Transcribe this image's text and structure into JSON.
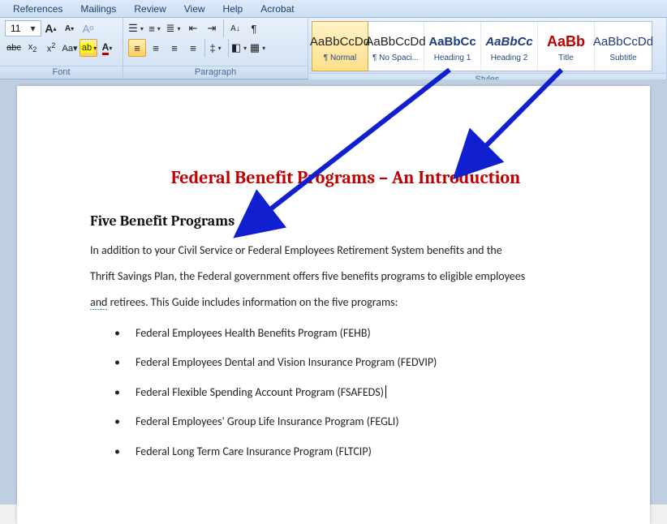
{
  "tabs": {
    "references": "References",
    "mailings": "Mailings",
    "review": "Review",
    "view": "View",
    "help": "Help",
    "acrobat": "Acrobat"
  },
  "font": {
    "group_label": "Font",
    "size": "11",
    "grow": "A",
    "shrink": "A",
    "clear": "Aa",
    "strike": "abc",
    "sub": "x₂",
    "sup": "x²",
    "case": "Aa"
  },
  "paragraph": {
    "group_label": "Paragraph",
    "bullets": "•",
    "numbers": "1",
    "ml": "≡",
    "dec": "⇤",
    "inc": "⇥",
    "sort": "A↓",
    "marks": "¶",
    "al": "≡",
    "ac": "≡",
    "ar": "≡",
    "aj": "≡",
    "ls": "‡",
    "shade": "◧",
    "border": "▦"
  },
  "styles": {
    "group_label": "Styles",
    "preview": "AaBbCcDd",
    "preview_big": "AaBbCc",
    "preview_title": "AaBb",
    "items": [
      {
        "name": "¶ Normal"
      },
      {
        "name": "¶ No Spaci..."
      },
      {
        "name": "Heading 1"
      },
      {
        "name": "Heading 2"
      },
      {
        "name": "Title"
      },
      {
        "name": "Subtitle"
      }
    ]
  },
  "doc": {
    "title": "Federal Benefit Programs – An Introduction",
    "heading": "Five Benefit Programs",
    "para_frag1": "In addition to your Civil Service or Federal Employees Retirement System benefits and the",
    "para_frag2": "Thrift Savings Plan, the Federal government offers five benefits programs to eligible employees",
    "para_frag3_pre": "and",
    "para_frag3_post": " retirees. This Guide includes information on the five programs:",
    "list": [
      "Federal Employees Health Benefits Program (FEHB)",
      "Federal Employees Dental and Vision Insurance Program (FEDVIP)",
      "Federal Flexible Spending Account Program (FSAFEDS)",
      "Federal Employees' Group Life Insurance Program (FEGLI)",
      "Federal Long Term Care Insurance Program (FLTCIP)"
    ]
  }
}
